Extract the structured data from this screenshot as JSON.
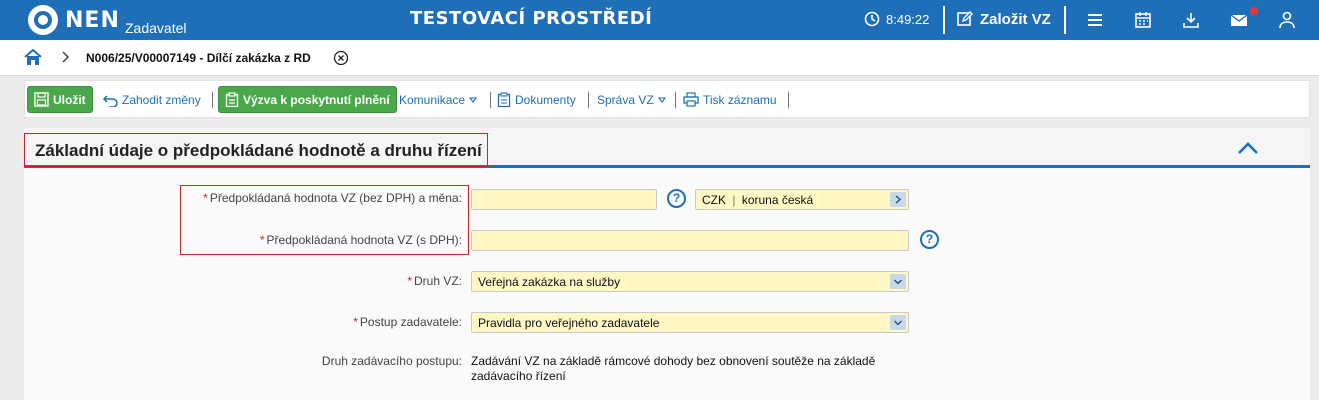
{
  "header": {
    "logo": "NEN",
    "logo_sub": "Zadavatel",
    "env_title": "TESTOVACÍ PROSTŘEDÍ",
    "time": "8:49:22",
    "create_label": "Založit VZ",
    "colors": {
      "primary": "#1e6fb8",
      "notification": "#e53935"
    }
  },
  "breadcrumb": {
    "item": "N006/25/V00007149 - Dílčí zakázka z RD"
  },
  "toolbar": {
    "save": "Uložit",
    "discard": "Zahodit změny",
    "call": "Výzva k poskytnutí plnění",
    "communication": "Komunikace",
    "documents": "Dokumenty",
    "manage": "Správa VZ",
    "print": "Tisk záznamu"
  },
  "section": {
    "title": "Základní údaje o předpokládané hodnotě a druhu řízení"
  },
  "form": {
    "value_excl_label": "Předpokládaná hodnota VZ (bez DPH) a měna:",
    "value_excl": "",
    "currency_code": "CZK",
    "currency_name": "koruna česká",
    "value_incl_label": "Předpokládaná hodnota VZ (s DPH):",
    "value_incl": "",
    "type_label": "Druh VZ:",
    "type_value": "Veřejná zakázka na služby",
    "procedure_label": "Postup zadavatele:",
    "procedure_value": "Pravidla pro veřejného zadavatele",
    "award_label": "Druh zadávacího postupu:",
    "award_value": "Zadávání VZ na základě rámcové dohody bez obnovení soutěže na základě zadávacího řízení"
  }
}
